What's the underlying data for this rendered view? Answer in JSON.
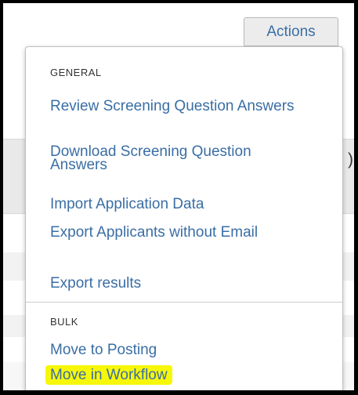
{
  "actions_button": {
    "label": "Actions"
  },
  "background": {
    "partial_char": ")"
  },
  "menu": {
    "general": {
      "header": "GENERAL",
      "items": [
        "Review Screening Question Answers",
        "Download Screening Question Answers",
        "Import Application Data",
        "Export Applicants without Email",
        "Export results"
      ]
    },
    "bulk": {
      "header": "BULK",
      "items": [
        "Move to Posting",
        "Move in Workflow"
      ]
    }
  },
  "colors": {
    "link": "#3a6ea5",
    "highlight": "#f7f70a",
    "frame": "#000000"
  }
}
